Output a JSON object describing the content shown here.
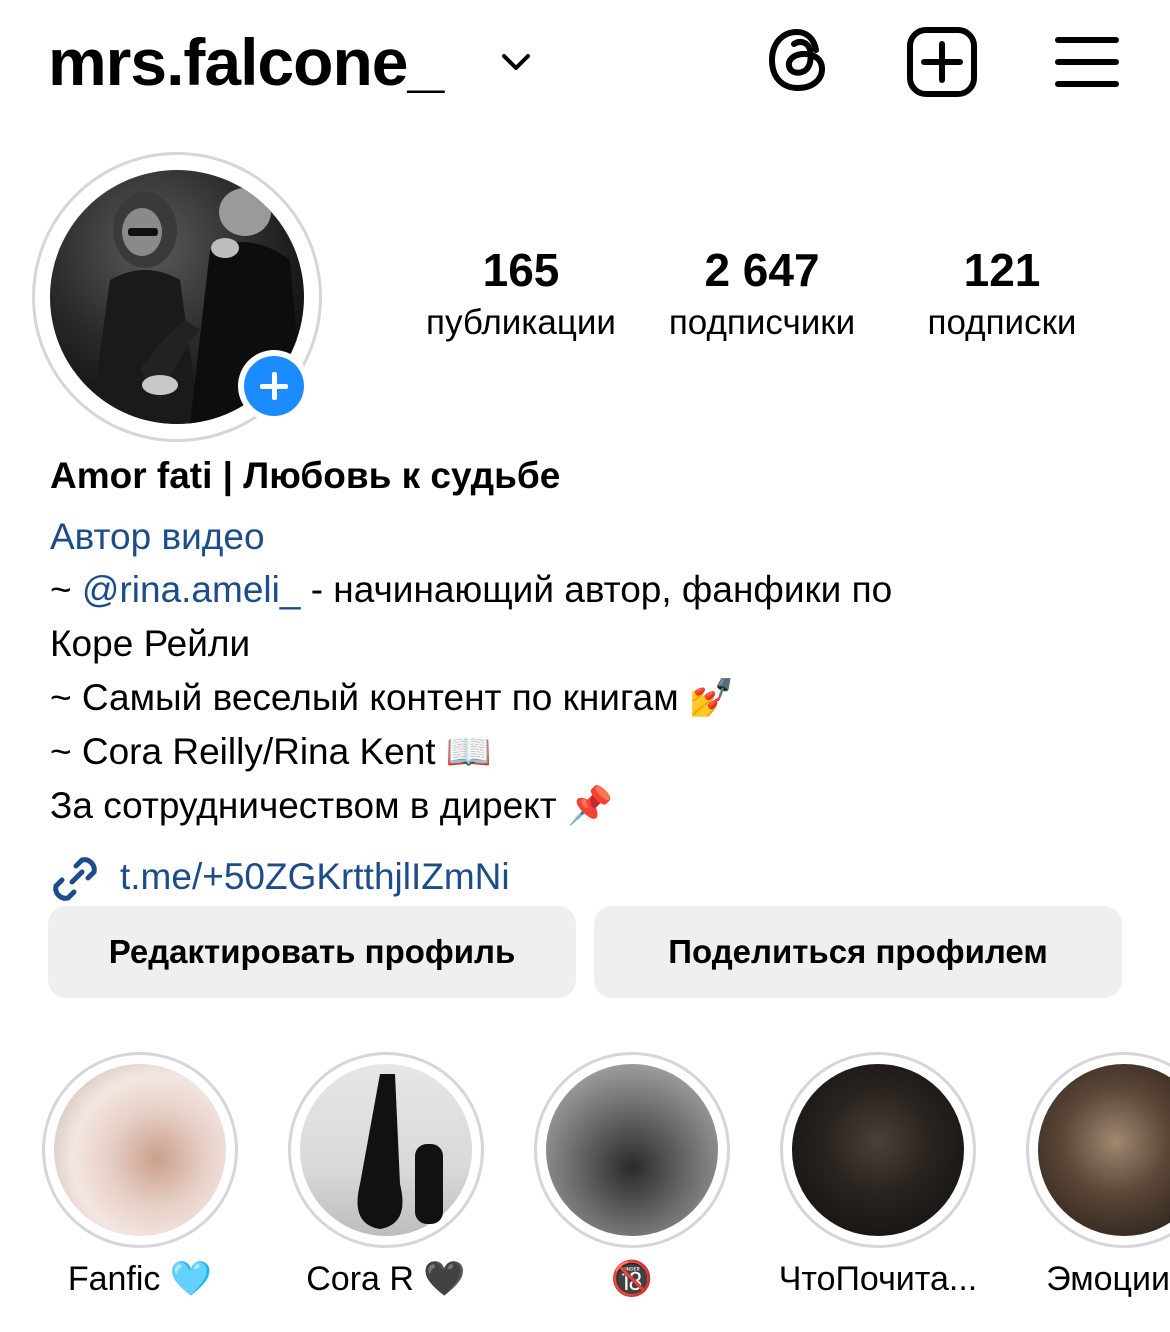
{
  "header": {
    "username": "mrs.falcone_"
  },
  "stats": [
    {
      "value": "165",
      "label": "публикации"
    },
    {
      "value": "2 647",
      "label": "подписчики"
    },
    {
      "value": "121",
      "label": "подписки"
    }
  ],
  "bio": {
    "name": "Amor fati | Любовь к судьбе",
    "category": "Автор видео",
    "line1_prefix": "~ ",
    "line1_mention": "@rina.ameli_",
    "line1_suffix": "  - начинающий автор, фанфики по",
    "line2": "Коре Рейли",
    "line3": "~ Самый веселый контент по книгам 💅",
    "line4": "~ Cora Reilly/Rina Kent 📖",
    "line5": "За сотрудничеством в директ 📌",
    "link": "t.me/+50ZGKrtthjlIZmNi"
  },
  "buttons": {
    "edit": "Редактировать профиль",
    "share": "Поделиться профилем"
  },
  "highlights": [
    {
      "label": "Fanfic 🩵"
    },
    {
      "label": "Cora R 🖤"
    },
    {
      "label": "🔞"
    },
    {
      "label": "ЧтоПочита..."
    },
    {
      "label": "Эмоции"
    }
  ],
  "colors": {
    "link_blue": "#1c4d8a",
    "add_badge": "#1a8cff",
    "button_bg": "#efeff1"
  },
  "icons": {
    "header": [
      "chevron-down-icon",
      "threads-icon",
      "plus-square-icon",
      "menu-icon"
    ],
    "bio": [
      "link-icon"
    ]
  }
}
